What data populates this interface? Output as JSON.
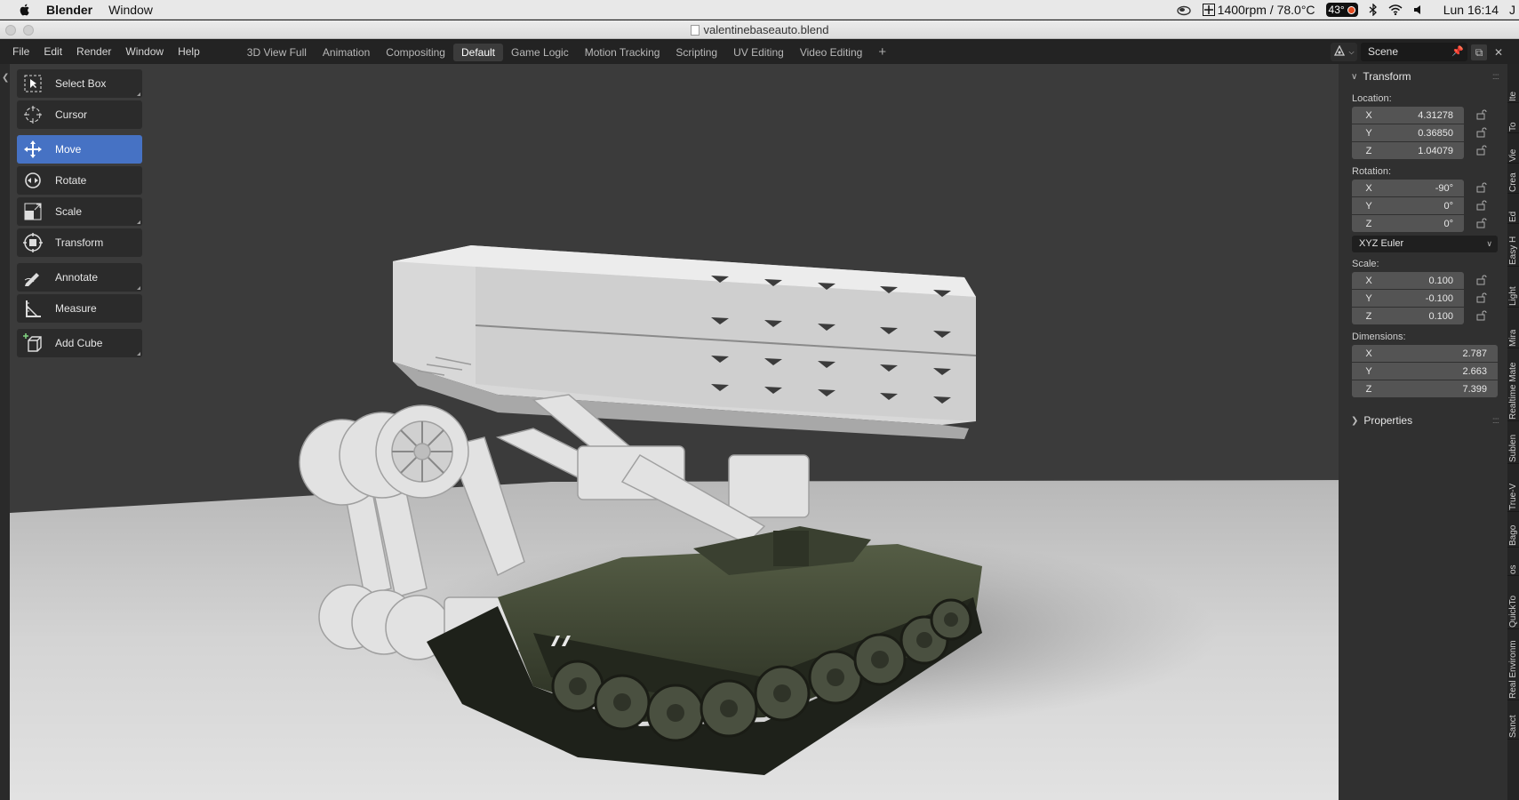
{
  "macos": {
    "app_name": "Blender",
    "menus": [
      "Window"
    ],
    "fan_status": "1400rpm / 78.0°C",
    "temp_badge": "43°",
    "clock": "Lun 16:14",
    "user_initial": "J"
  },
  "window": {
    "title": "valentinebaseauto.blend"
  },
  "topbar": {
    "menus": [
      "File",
      "Edit",
      "Render",
      "Window",
      "Help"
    ],
    "workspaces": [
      "3D View Full",
      "Animation",
      "Compositing",
      "Default",
      "Game Logic",
      "Motion Tracking",
      "Scripting",
      "UV Editing",
      "Video Editing"
    ],
    "active_workspace": "Default",
    "add_workspace": "+",
    "scene_name": "Scene"
  },
  "toolbar": {
    "tools": [
      {
        "label": "Select Box",
        "icon": "select-box-icon",
        "active": false
      },
      {
        "label": "Cursor",
        "icon": "cursor-icon",
        "active": false
      },
      {
        "label": "Move",
        "icon": "move-icon",
        "active": true
      },
      {
        "label": "Rotate",
        "icon": "rotate-icon",
        "active": false
      },
      {
        "label": "Scale",
        "icon": "scale-icon",
        "active": false
      },
      {
        "label": "Transform",
        "icon": "transform-icon",
        "active": false
      },
      {
        "label": "Annotate",
        "icon": "annotate-icon",
        "active": false
      },
      {
        "label": "Measure",
        "icon": "measure-icon",
        "active": false
      },
      {
        "label": "Add Cube",
        "icon": "add-cube-icon",
        "active": false
      }
    ]
  },
  "npanel": {
    "transform_header": "Transform",
    "location": {
      "label": "Location:",
      "x": "4.31278",
      "y": "0.36850",
      "z": "1.04079"
    },
    "rotation": {
      "label": "Rotation:",
      "x": "-90°",
      "y": "0°",
      "z": "0°"
    },
    "rotation_mode": "XYZ Euler",
    "scale": {
      "label": "Scale:",
      "x": "0.100",
      "y": "-0.100",
      "z": "0.100"
    },
    "dimensions": {
      "label": "Dimensions:",
      "x": "2.787",
      "y": "2.663",
      "z": "7.399"
    },
    "axis_x": "X",
    "axis_y": "Y",
    "axis_z": "Z",
    "properties_header": "Properties"
  },
  "vertical_tabs": [
    "Ite",
    "To",
    "Vie",
    "Crea",
    "Ed",
    "Easy H",
    "Light",
    "Mira",
    "Realtime Mate",
    "Sublen",
    "True-V",
    "Bago",
    "os",
    "QuickTo",
    "Real Environm",
    "Sanct"
  ],
  "colors": {
    "accent": "#4672c4",
    "panel_bg": "#303030",
    "viewport_bg": "#3b3b3b"
  }
}
